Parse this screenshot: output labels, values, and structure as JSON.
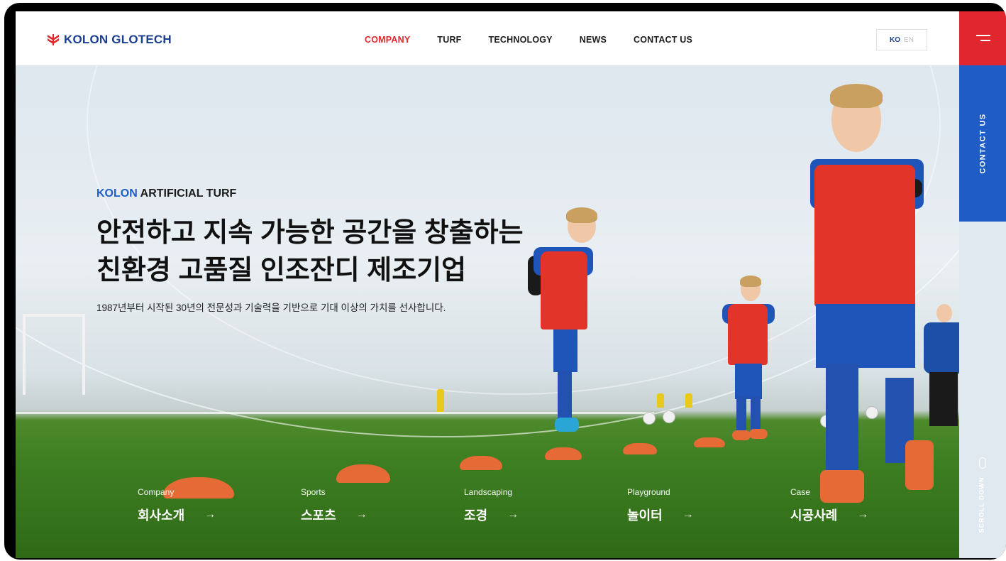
{
  "header": {
    "logo_text": "KOLON GLOTECH",
    "nav": [
      {
        "label": "COMPANY",
        "active": true
      },
      {
        "label": "TURF",
        "active": false
      },
      {
        "label": "TECHNOLOGY",
        "active": false
      },
      {
        "label": "NEWS",
        "active": false
      },
      {
        "label": "CONTACT US",
        "active": false
      }
    ],
    "lang_active": "KO",
    "lang_inactive": "EN"
  },
  "side": {
    "contact_label": "CONTACT US",
    "scroll_label": "SCROLL DOWN"
  },
  "hero": {
    "eyebrow_accent": "KOLON",
    "eyebrow_rest": " ARTIFICIAL TURF",
    "headline_line1": "안전하고 지속 가능한 공간을 창출하는",
    "headline_line2": "친환경 고품질 인조잔디 제조기업",
    "subline": "1987년부터 시작된 30년의 전문성과 기술력을 기반으로 기대 이상의 가치를 선사합니다."
  },
  "categories": [
    {
      "en": "Company",
      "ko": "회사소개",
      "arrow": "→"
    },
    {
      "en": "Sports",
      "ko": "스포츠",
      "arrow": "→"
    },
    {
      "en": "Landscaping",
      "ko": "조경",
      "arrow": "→"
    },
    {
      "en": "Playground",
      "ko": "놀이터",
      "arrow": "→"
    },
    {
      "en": "Case",
      "ko": "시공사례",
      "arrow": "→"
    }
  ],
  "colors": {
    "brand_blue": "#1b3f8f",
    "accent_red": "#e1262d",
    "contact_blue": "#1f5cc6"
  },
  "icons": {
    "logo": "kolon-logo-icon",
    "menu": "hamburger-menu-icon",
    "scroll": "mouse-scroll-icon",
    "arrow": "arrow-right-icon"
  }
}
